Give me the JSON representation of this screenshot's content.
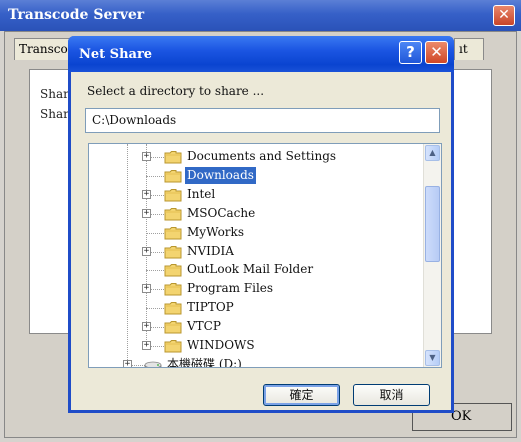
{
  "background_window": {
    "title": "Transcode Server",
    "close_glyph": "✕",
    "tabs": [
      "Transco",
      "ıt"
    ],
    "list_items": [
      "Share",
      "Share"
    ],
    "ok_label": "OK"
  },
  "dialog": {
    "title": "Net Share",
    "help_glyph": "?",
    "close_glyph": "✕",
    "prompt": "Select a directory to share ...",
    "path_value": "C:\\Downloads",
    "tree": [
      {
        "label": "Documents and Settings",
        "expander": "+",
        "icon": "folder-icon"
      },
      {
        "label": "Downloads",
        "expander": "",
        "icon": "folder-icon",
        "selected": true
      },
      {
        "label": "Intel",
        "expander": "+",
        "icon": "folder-icon"
      },
      {
        "label": "MSOCache",
        "expander": "+",
        "icon": "folder-icon"
      },
      {
        "label": "MyWorks",
        "expander": "",
        "icon": "folder-icon"
      },
      {
        "label": "NVIDIA",
        "expander": "+",
        "icon": "folder-icon"
      },
      {
        "label": "OutLook Mail Folder",
        "expander": "",
        "icon": "folder-icon"
      },
      {
        "label": "Program Files",
        "expander": "+",
        "icon": "folder-icon"
      },
      {
        "label": "TIPTOP",
        "expander": "",
        "icon": "folder-icon"
      },
      {
        "label": "VTCP",
        "expander": "+",
        "icon": "folder-icon"
      },
      {
        "label": "WINDOWS",
        "expander": "+",
        "icon": "folder-icon"
      },
      {
        "label": "本機磁碟 (D:)",
        "expander": "+",
        "icon": "drive-icon"
      }
    ],
    "ok_label": "確定",
    "cancel_label": "取消",
    "scroll_up_glyph": "▲",
    "scroll_down_glyph": "▼"
  },
  "colors": {
    "title_blue": "#1b55e2",
    "selection_blue": "#3169c6",
    "close_red": "#d04727",
    "folder_yellow": "#f3d470"
  }
}
